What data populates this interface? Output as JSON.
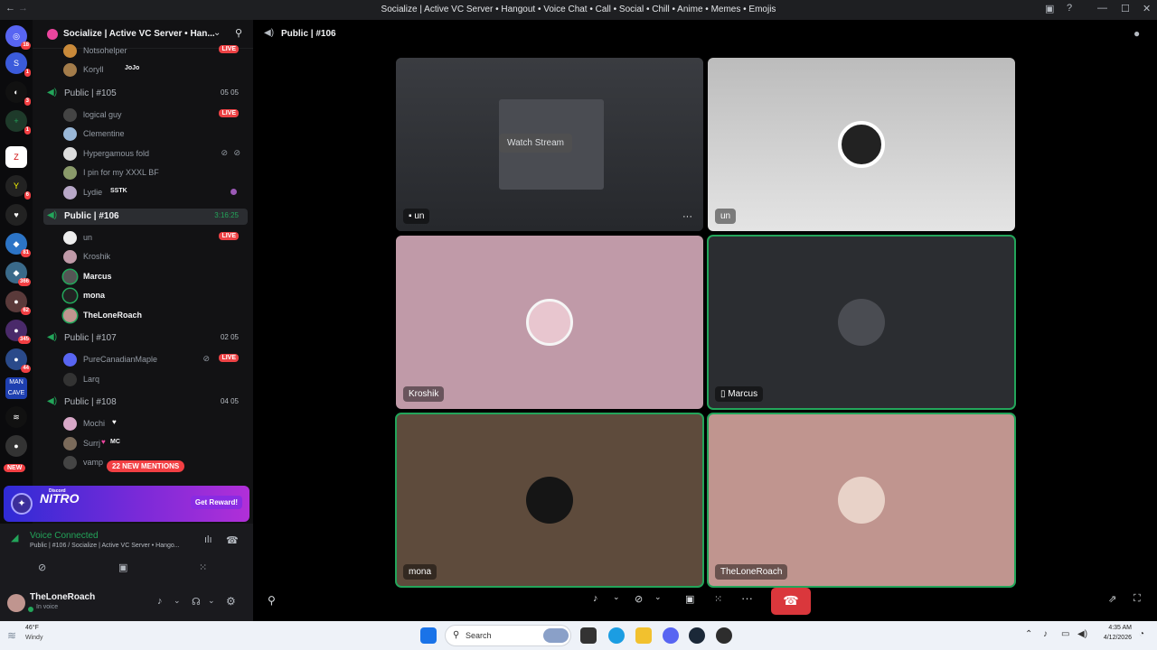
{
  "window": {
    "title": "Socialize | Active VC Server • Hangout • Voice Chat • Call • Social • Chill • Anime • Memes • Emojis"
  },
  "rail": {
    "badges": [
      "18",
      "1",
      "3",
      "1",
      "6",
      "81",
      "366",
      "62",
      "345",
      "44"
    ],
    "new_label": "NEW"
  },
  "server": {
    "name": "Socialize | Active VC Server • Han..."
  },
  "channels": {
    "top_users": [
      {
        "name": "Notsohelper",
        "live": "LIVE"
      },
      {
        "name": "Koryll",
        "tag": "JoJo"
      }
    ],
    "c105": {
      "name": "Public | #105",
      "count": "05  05",
      "users": [
        {
          "name": "logical guy",
          "live": "LIVE"
        },
        {
          "name": "Clementine"
        },
        {
          "name": "Hypergamous fold"
        },
        {
          "name": "I pin for my XXXL BF"
        },
        {
          "name": "Lydie",
          "tag": "SSTK"
        }
      ]
    },
    "c106": {
      "name": "Public | #106",
      "timer": "3:16:25",
      "users": [
        {
          "name": "un",
          "live": "LIVE"
        },
        {
          "name": "Kroshik"
        },
        {
          "name": "Marcus"
        },
        {
          "name": "mona"
        },
        {
          "name": "TheLoneRoach"
        }
      ]
    },
    "c107": {
      "name": "Public | #107",
      "count": "02  05",
      "users": [
        {
          "name": "PureCanadianMaple",
          "live": "LIVE"
        },
        {
          "name": "Larq"
        }
      ]
    },
    "c108": {
      "name": "Public | #108",
      "count": "04  05",
      "users": [
        {
          "name": "Mochi"
        },
        {
          "name": "Surrj",
          "tag": "MC"
        },
        {
          "name": "vamp"
        }
      ]
    },
    "mentions": "22 NEW MENTIONS"
  },
  "nitro": {
    "sub": "Discord",
    "logo": "NITRO",
    "button": "Get Reward!"
  },
  "voice": {
    "status": "Voice Connected",
    "location": "Public | #106 / Socialize | Active VC Server • Hango..."
  },
  "user": {
    "name": "TheLoneRoach",
    "status": "In voice"
  },
  "main": {
    "channel": "Public | #106",
    "watch_label": "Watch Stream",
    "tiles": [
      {
        "name": "un"
      },
      {
        "name": "un"
      },
      {
        "name": "Kroshik"
      },
      {
        "name": "Marcus"
      },
      {
        "name": "mona"
      },
      {
        "name": "TheLoneRoach"
      }
    ]
  },
  "taskbar": {
    "weather_temp": "46°F",
    "weather_desc": "Windy",
    "search": "Search",
    "time": "4:35 AM",
    "date": "4/12/2026"
  },
  "colors": {
    "online_green": "#23a55a",
    "live_red": "#ed4245",
    "tile_pink": "#c09aa8",
    "tile_dark": "#2b2d31",
    "tile_brown": "#5e4b3c",
    "tile_rose": "#c0958f",
    "tile_light": "#d4d4d4"
  }
}
